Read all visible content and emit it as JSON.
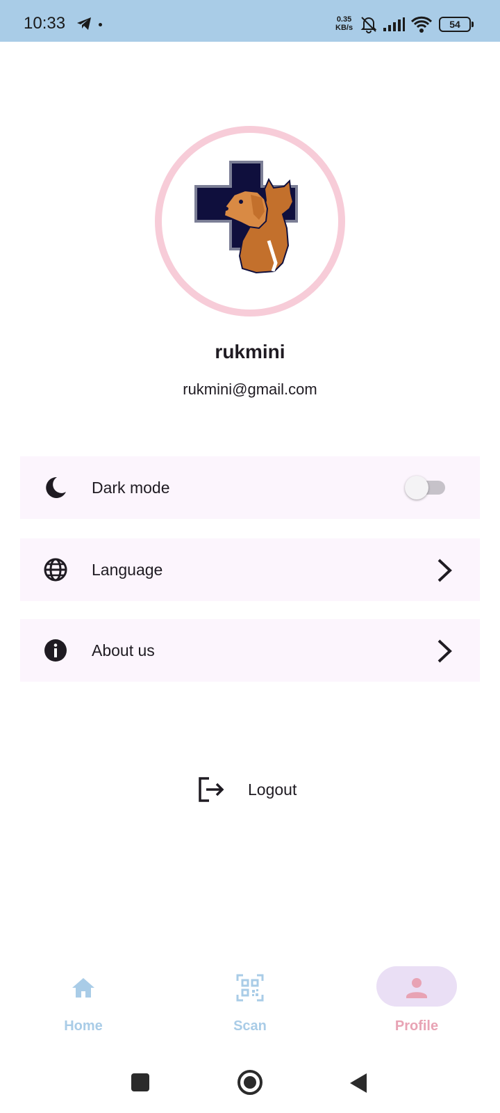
{
  "status_bar": {
    "time": "10:33",
    "net_speed_value": "0.35",
    "net_speed_unit": "KB/s",
    "battery": "54",
    "icons": [
      "telegram-icon",
      "mute-bell-icon",
      "signal-icon",
      "wifi-icon",
      "battery-icon"
    ]
  },
  "profile": {
    "name": "rukmini",
    "email": "rukmini@gmail.com",
    "avatar": "pet-care-logo"
  },
  "settings": {
    "dark_mode": {
      "label": "Dark mode",
      "icon": "moon-icon",
      "enabled": false
    },
    "language": {
      "label": "Language",
      "icon": "globe-icon"
    },
    "about": {
      "label": "About us",
      "icon": "info-icon"
    }
  },
  "logout": {
    "label": "Logout",
    "icon": "logout-icon"
  },
  "bottom_nav": {
    "items": [
      {
        "label": "Home",
        "icon": "home-icon",
        "active": false
      },
      {
        "label": "Scan",
        "icon": "qr-scan-icon",
        "active": false
      },
      {
        "label": "Profile",
        "icon": "person-icon",
        "active": true
      }
    ]
  },
  "colors": {
    "status_bar": "#a9cce7",
    "row_background": "#fcf5fd",
    "avatar_ring": "#f7ccd8",
    "active_pill": "#eadff5",
    "active_label": "#e8a3b4",
    "inactive_nav": "#a9cce7"
  }
}
